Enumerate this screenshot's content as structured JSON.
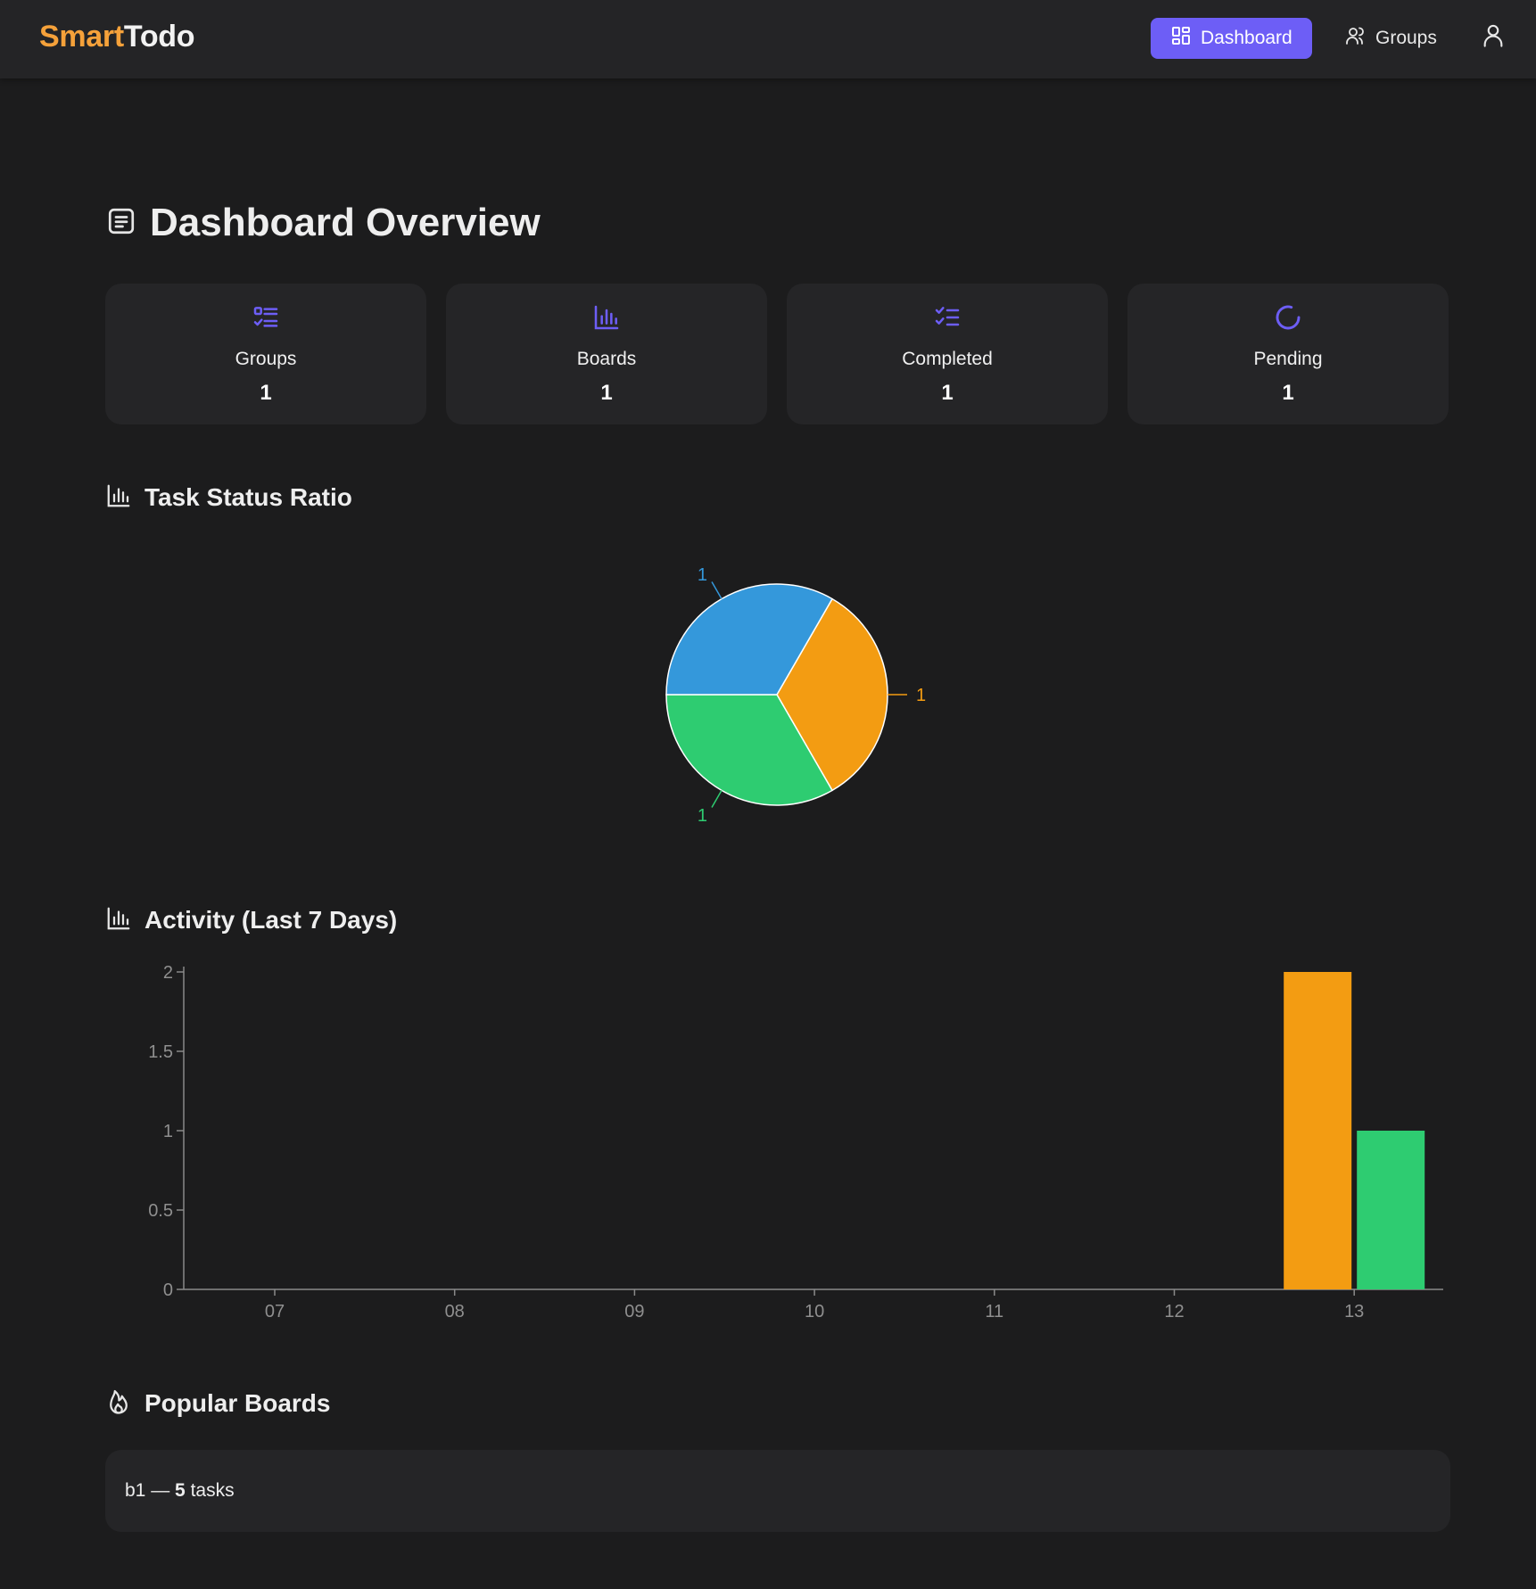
{
  "app": {
    "brand_part1": "Smart",
    "brand_part2": "Todo",
    "accent_color": "#6d5ef6",
    "brand_color": "#f5a13a"
  },
  "nav": {
    "items": [
      {
        "label": "Dashboard",
        "icon": "dashboard-grid-icon",
        "active": true
      },
      {
        "label": "Groups",
        "icon": "users-icon",
        "active": false
      }
    ],
    "user_icon": "user-icon"
  },
  "page": {
    "title": "Dashboard Overview",
    "title_icon": "document-list-icon"
  },
  "stats": [
    {
      "label": "Groups",
      "value": "1",
      "icon": "list-check-icon"
    },
    {
      "label": "Boards",
      "value": "1",
      "icon": "bar-chart-icon"
    },
    {
      "label": "Completed",
      "value": "1",
      "icon": "checklist-icon"
    },
    {
      "label": "Pending",
      "value": "1",
      "icon": "loader-icon"
    }
  ],
  "sections": {
    "status_title": "Task Status Ratio",
    "activity_title": "Activity (Last 7 Days)",
    "popular_title": "Popular Boards"
  },
  "chart_data": [
    {
      "type": "pie",
      "title": "Task Status Ratio",
      "slices": [
        {
          "value": 1,
          "label": "1",
          "color": "#f39c12"
        },
        {
          "value": 1,
          "label": "1",
          "color": "#2ecc71"
        },
        {
          "value": 1,
          "label": "1",
          "color": "#3498db"
        }
      ]
    },
    {
      "type": "bar",
      "title": "Activity (Last 7 Days)",
      "categories": [
        "07",
        "08",
        "09",
        "10",
        "11",
        "12",
        "13"
      ],
      "series": [
        {
          "values": [
            0,
            0,
            0,
            0,
            0,
            0,
            2
          ],
          "color": "#f39c12"
        },
        {
          "values": [
            0,
            0,
            0,
            0,
            0,
            0,
            1
          ],
          "color": "#2ecc71"
        }
      ],
      "ylim": [
        0,
        2
      ],
      "yticks": [
        "0",
        "0.5",
        "1",
        "1.5",
        "2"
      ],
      "grid": false
    }
  ],
  "popular_boards": [
    {
      "name": "b1",
      "separator": "—",
      "count": "5",
      "suffix": "tasks"
    }
  ]
}
